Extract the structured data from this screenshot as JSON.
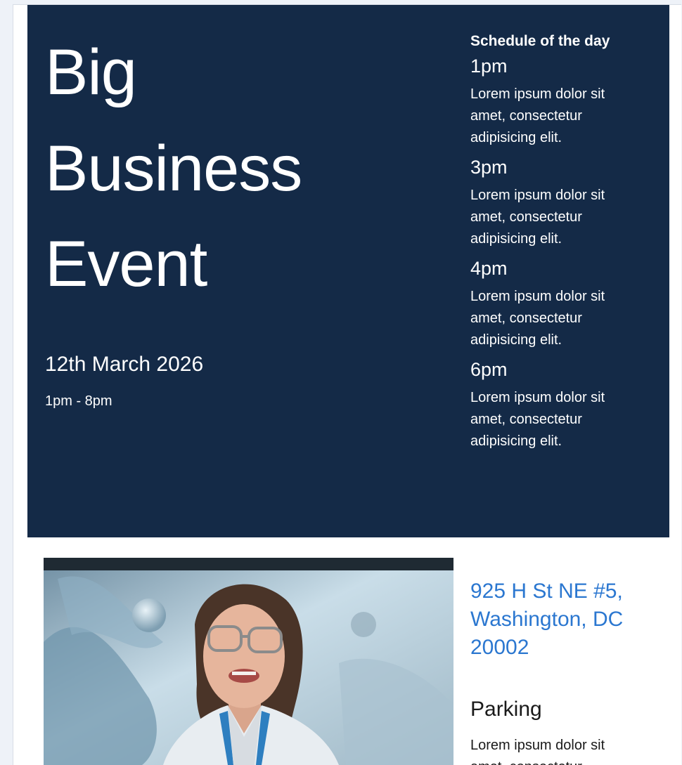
{
  "event": {
    "title_lines": [
      "Big",
      "Business",
      "Event"
    ],
    "date": "12th March 2026",
    "time": "1pm - 8pm"
  },
  "schedule": {
    "heading": "Schedule of the day",
    "items": [
      {
        "time": "1pm",
        "description": "Lorem ipsum dolor sit amet, consectetur adipisicing elit."
      },
      {
        "time": "3pm",
        "description": "Lorem ipsum dolor sit amet, consectetur adipisicing elit."
      },
      {
        "time": "4pm",
        "description": "Lorem ipsum dolor sit amet, consectetur adipisicing elit."
      },
      {
        "time": "6pm",
        "description": "Lorem ipsum dolor sit amet, consectetur adipisicing elit."
      }
    ]
  },
  "location": {
    "address": "925 H St NE #5, Washington, DC 20002",
    "parking_title": "Parking",
    "parking_description": "Lorem ipsum dolor sit amet, consectetur"
  },
  "colors": {
    "hero_background": "#142a47",
    "address_link": "#2b77d0"
  }
}
